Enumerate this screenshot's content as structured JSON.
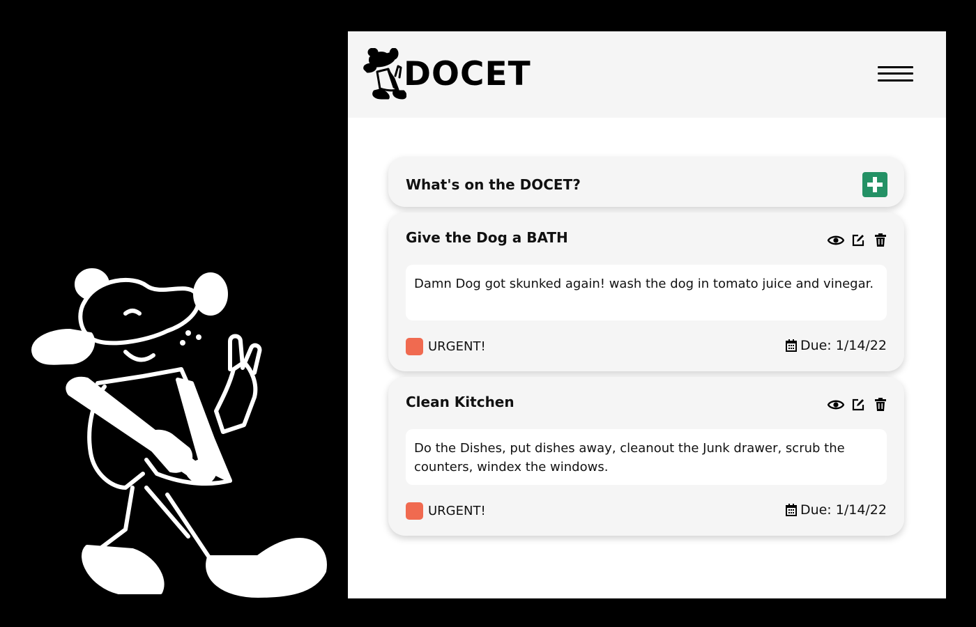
{
  "app": {
    "logo_text": "DOCET"
  },
  "header": {
    "title": "What's on the DOCET?"
  },
  "tasks": [
    {
      "title": "Give the Dog a BATH",
      "description": "Damn Dog got skunked again! wash the dog in tomato juice and vinegar.",
      "priority": "URGENT!",
      "priority_color": "#f06a50",
      "due": "Due: 1/14/22"
    },
    {
      "title": "Clean Kitchen",
      "description": "Do the Dishes, put dishes away, cleanout the Junk drawer, scrub the counters, windex the windows.",
      "priority": "URGENT!",
      "priority_color": "#f06a50",
      "due": "Due: 1/14/22"
    }
  ],
  "colors": {
    "accent_green": "#249165",
    "urgent": "#f06a50",
    "panel_bg": "#f5f5f5"
  },
  "icons": {
    "menu": "hamburger-menu-icon",
    "add": "plus-square-icon",
    "view": "eye-icon",
    "edit": "edit-icon",
    "delete": "trash-icon",
    "due": "calendar-icon"
  }
}
